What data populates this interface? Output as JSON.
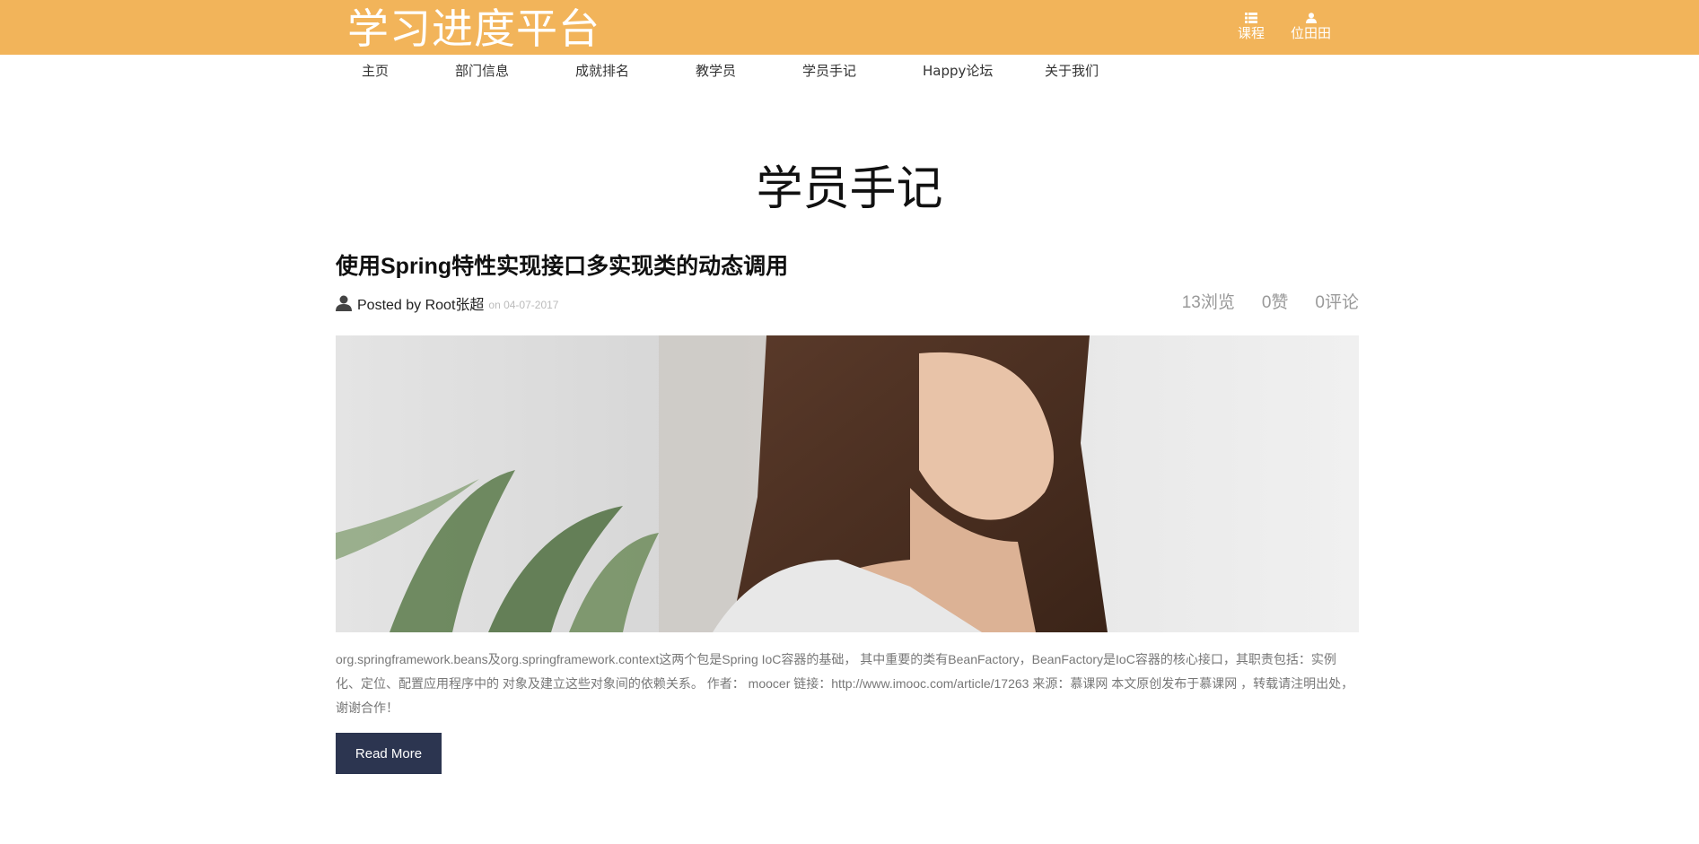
{
  "header": {
    "logo": "学习进度平台",
    "links": [
      {
        "label": "课程",
        "icon": "list-icon"
      },
      {
        "label": "位田田",
        "icon": "user-icon"
      }
    ],
    "bg_color": "#f2b45a"
  },
  "nav": {
    "items": [
      "主页",
      "部门信息",
      "成就排名",
      "教学员",
      "学员手记",
      "Happy论坛",
      "关于我们"
    ]
  },
  "page": {
    "title": "学员手记"
  },
  "post": {
    "title": "使用Spring特性实现接口多实现类的动态调用",
    "author": "Posted by Root张超",
    "date": "on 04-07-2017",
    "stats": {
      "views": "13浏览",
      "likes": "0赞",
      "comments": "0评论"
    },
    "image_alt": "woman looking down beside a plant",
    "excerpt": "org.springframework.beans及org.springframework.context这两个包是Spring IoC容器的基础， 其中重要的类有BeanFactory，BeanFactory是IoC容器的核心接口，其职责包括：实例化、定位、配置应用程序中的 对象及建立这些对象间的依赖关系。 作者： moocer 链接：http://www.imooc.com/article/17263 来源：慕课网 本文原创发布于慕课网 ，转载请注明出处，谢谢合作！",
    "read_more": "Read More",
    "button_color": "#2c3550"
  }
}
